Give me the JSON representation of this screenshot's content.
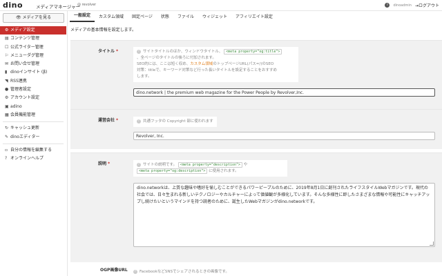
{
  "header": {
    "logo": "dino",
    "title": "メディアマネージャー",
    "user_prefix": "@",
    "user_handle": "revolver",
    "top_user": "dinoadmin",
    "logout_label": "ログアウト"
  },
  "sidebar": {
    "view_media_label": "メディアを見る",
    "items": [
      {
        "label": "メディア設定",
        "icon": "gear-icon",
        "glyph": "⚙"
      },
      {
        "label": "コンテンツ管理",
        "icon": "file-icon",
        "glyph": "▤"
      },
      {
        "label": "公式ライター管理",
        "icon": "user-icon",
        "glyph": "☐"
      },
      {
        "label": "メニューダグ管理",
        "icon": "tag-icon",
        "glyph": "⚐"
      },
      {
        "label": "お問い合せ管理",
        "icon": "mail-icon",
        "glyph": "✉"
      },
      {
        "label": "dinoインサイト (β)",
        "icon": "chart-icon",
        "glyph": "▮"
      },
      {
        "label": "RSS連携",
        "icon": "rss-icon",
        "glyph": "◥"
      },
      {
        "label": "管理者設定",
        "icon": "admin-icon",
        "glyph": "●"
      },
      {
        "label": "アカウント設定",
        "icon": "account-icon",
        "glyph": "⚙"
      },
      {
        "label": "adino",
        "icon": "adino-icon",
        "glyph": "▣"
      },
      {
        "label": "会員機能管理",
        "icon": "members-icon",
        "glyph": "▦"
      }
    ],
    "group2": [
      {
        "label": "キャッシュ更新",
        "icon": "refresh-icon",
        "glyph": "↻"
      },
      {
        "label": "dinoエディター",
        "icon": "pencil-icon",
        "glyph": "✎"
      }
    ],
    "group3": [
      {
        "label": "自分の情報を編集する",
        "icon": "lock-icon",
        "glyph": "🔒"
      },
      {
        "label": "オンラインヘルプ",
        "icon": "help-icon",
        "glyph": "?"
      }
    ]
  },
  "tabs": [
    "一般設定",
    "カスタム領域",
    "固定ページ",
    "状態",
    "ファイル",
    "ウィジェット",
    "アフィリエイト設定"
  ],
  "page": {
    "description": "メディアの基本情報を設定します。"
  },
  "fields": {
    "title": {
      "label": "タイトル",
      "required": "*",
      "hint_1": "サイトタイトルのほか、ウィンドウタイトル、",
      "hint_code": "<meta property=\"og:title\">",
      "hint_2": "、全ページのタイトルの後ろに付加されます。",
      "hint_3": "SEO的には、ここは短く収め、",
      "hint_hl": "カスタム領域",
      "hint_4": "のトップページURL(パス=/)のSEO",
      "hint_5": "対策：titleで、キーワード対策など行った長いタイトルを設定することをおすすめ",
      "hint_6": "します。",
      "value": "dino.network | the premium web magazine for the Power People by Revolver,Inc."
    },
    "company": {
      "label": "運営会社",
      "required": "*",
      "hint": "共通フッタの Copyright 部に使われます",
      "value": "Revolver, Inc."
    },
    "description": {
      "label": "説明",
      "required": "*",
      "hint_1": "サイトの説明です。",
      "hint_code1": "<meta property=\"description\">",
      "hint_2": "や",
      "hint_code2": "<meta property=\"og:description\">",
      "hint_3": "に使用されます。",
      "value": "dino.networkは、上質な趣味や嗜好を愉しむことができるパワーピープルのために、2019年8月1日に創刊されたライフスタイルWebマガジンです。現代の社会では、日々生まれる新しいテクノロジーやカルチャーによって価値観が多様化しています。そんな多様性に即したさまざまな情報や可能性にキャッチアップし続けたいというマインドを持つ読者のために、誕生したWebマガジンがdino.networkです。"
    },
    "ogp": {
      "label": "OGP画像URL",
      "hint": "FacebookなどSNSでシェアされるときの画像です。"
    }
  }
}
